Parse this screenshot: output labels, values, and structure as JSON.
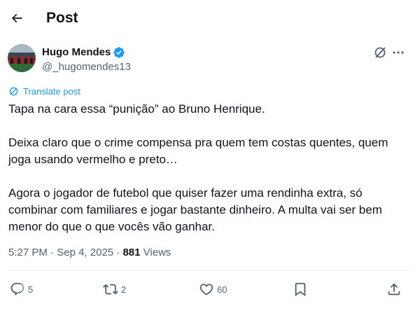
{
  "header": {
    "title": "Post",
    "back_icon": "arrow-left-icon"
  },
  "author": {
    "name": "Hugo Mendes",
    "handle": "@_hugomendes13",
    "verified_color": "#1d9bf0"
  },
  "translate_label": "Translate post",
  "tweet": {
    "paragraphs": [
      "Tapa na cara essa “punição” ao Bruno Henrique.",
      "Deixa claro que o crime compensa pra quem tem costas quentes, quem joga usando vermelho e preto…",
      "Agora o jogador de futebol que quiser fazer uma rendinha extra, só combinar com familiares e jogar bastante dinheiro. A multa vai ser bem menor do que o que vocês vão ganhar."
    ]
  },
  "meta": {
    "time": "5:27 PM",
    "separator": " · ",
    "date": "Sep 4, 2025",
    "separator2": " · ",
    "views_count": "881",
    "views_label": " Views"
  },
  "actions": {
    "replies": "5",
    "reposts": "2",
    "likes": "60"
  },
  "colors": {
    "accent": "#1d9bf0",
    "muted": "#536471",
    "text": "#0f1419"
  }
}
